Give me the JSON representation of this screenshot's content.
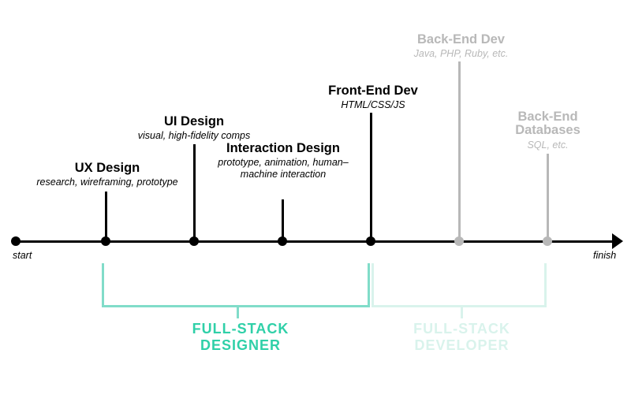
{
  "axis": {
    "start": "start",
    "finish": "finish"
  },
  "nodes": [
    {
      "key": "ux",
      "title": "UX Design",
      "sub": "research, wireframing, prototype",
      "faded": false
    },
    {
      "key": "ui",
      "title": "UI Design",
      "sub": "visual, high-fidelity comps",
      "faded": false
    },
    {
      "key": "ix",
      "title": "Interaction Design",
      "sub": "prototype, animation, human–machine interaction",
      "faded": false
    },
    {
      "key": "fe",
      "title": "Front-End Dev",
      "sub": "HTML/CSS/JS",
      "faded": false
    },
    {
      "key": "be_dev",
      "title": "Back-End Dev",
      "sub": "Java, PHP, Ruby, etc.",
      "faded": true
    },
    {
      "key": "be_db",
      "title": "Back-End Databases",
      "sub": "SQL, etc.",
      "faded": true
    }
  ],
  "groups": [
    {
      "key": "designer",
      "label": "FULL-STACK DESIGNER",
      "spans": [
        "ux",
        "ui",
        "ix",
        "fe"
      ],
      "tone": "teal"
    },
    {
      "key": "developer",
      "label": "FULL-STACK DEVELOPER",
      "spans": [
        "fe",
        "be_dev",
        "be_db"
      ],
      "tone": "faint"
    }
  ]
}
